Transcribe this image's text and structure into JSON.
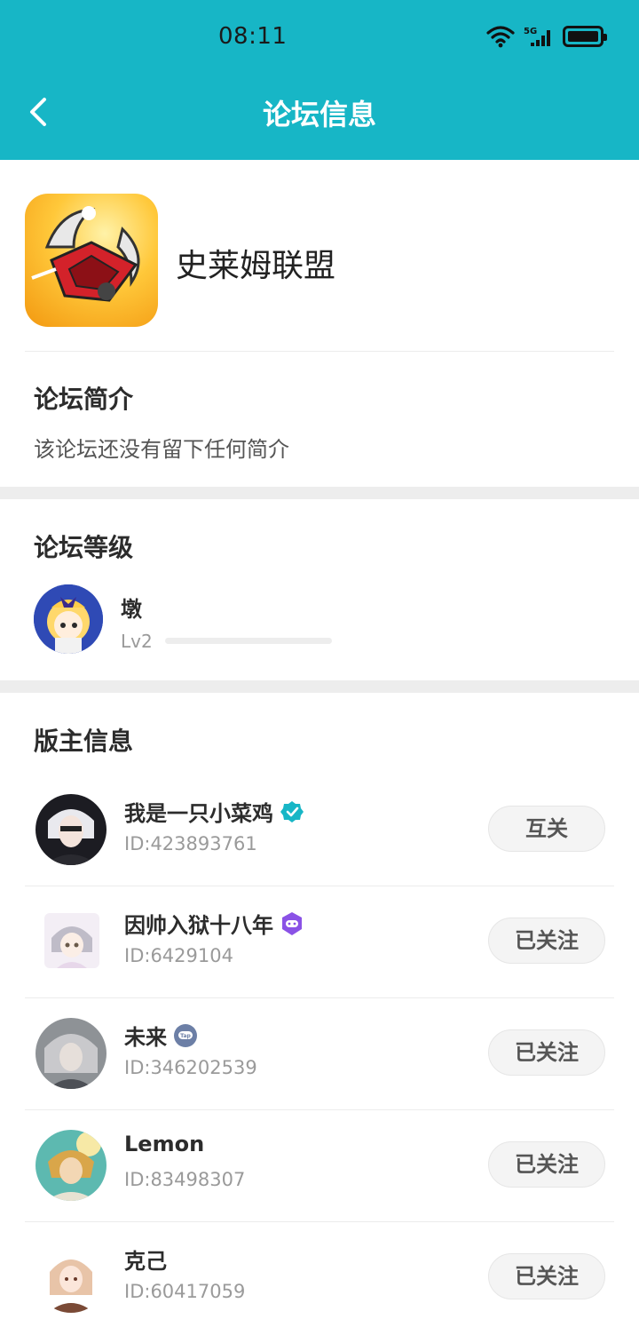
{
  "status_bar": {
    "time": "08:11"
  },
  "header": {
    "title": "论坛信息"
  },
  "forum": {
    "name": "史莱姆联盟"
  },
  "intro": {
    "title": "论坛简介",
    "text": "该论坛还没有留下任何简介"
  },
  "level": {
    "title": "论坛等级",
    "name": "墩",
    "level_text": "Lv2",
    "progress": 0.0
  },
  "moderators": {
    "title": "版主信息",
    "items": [
      {
        "name": "我是一只小菜鸡",
        "id": "ID:423893761",
        "button": "互关",
        "badge": "verified-icon"
      },
      {
        "name": "因帅入狱十八年",
        "id": "ID:6429104",
        "button": "已关注",
        "badge": "gamepad-badge-icon"
      },
      {
        "name": "未来",
        "id": "ID:346202539",
        "button": "已关注",
        "badge": "tap-badge-icon"
      },
      {
        "name": "Lemon",
        "id": "ID:83498307",
        "button": "已关注",
        "badge": ""
      },
      {
        "name": "克己",
        "id": "ID:60417059",
        "button": "已关注",
        "badge": ""
      }
    ]
  },
  "colors": {
    "accent": "#17b6c6",
    "verified": "#17b6c6",
    "gamepad_badge": "#8a52e6",
    "tap_badge": "#6c7fa6"
  }
}
